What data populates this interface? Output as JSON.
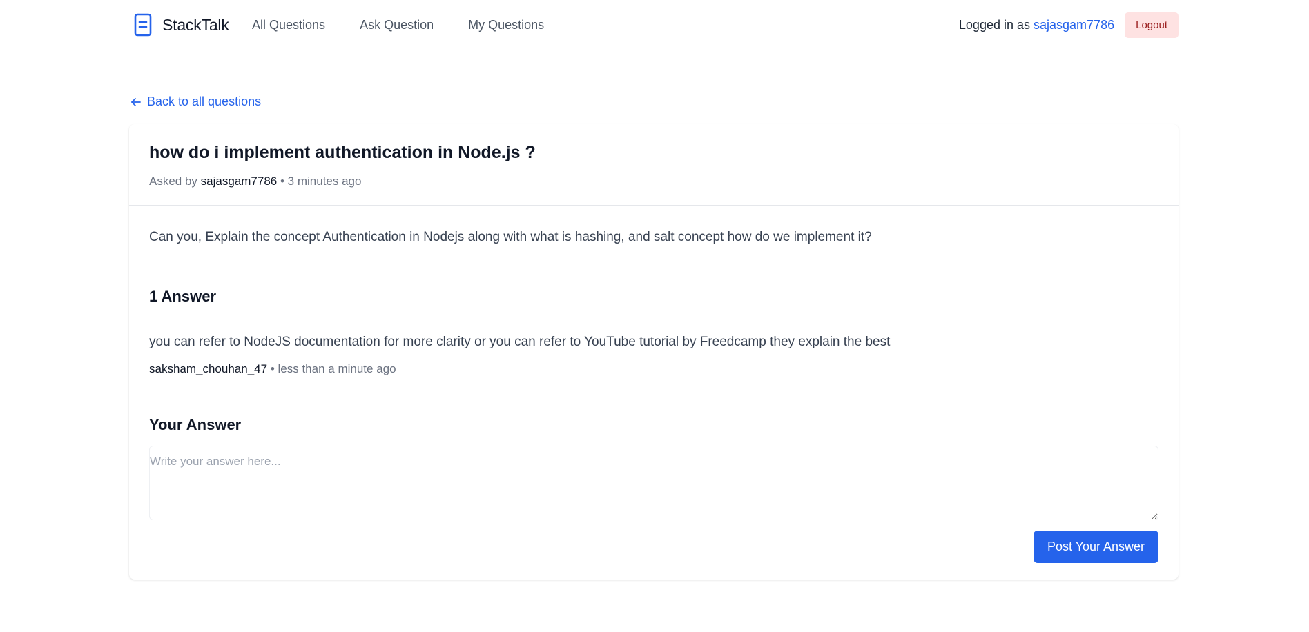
{
  "app": {
    "brand_name": "StackTalk",
    "brand_icon": "document-icon",
    "accent_color": "#2563eb"
  },
  "nav": {
    "links": [
      {
        "label": "All Questions"
      },
      {
        "label": "Ask Question"
      },
      {
        "label": "My Questions"
      }
    ],
    "logged_in_prefix": "Logged in as",
    "username": "sajasgam7786",
    "logout_label": "Logout"
  },
  "back_link": {
    "label": "Back to all questions",
    "icon": "arrow-left-icon"
  },
  "question": {
    "title": "how do i implement authentication in Node.js ?",
    "asked_by_prefix": "Asked by",
    "author": "sajasgam7786",
    "separator": "•",
    "time": "3 minutes ago",
    "body": "Can you, Explain the concept Authentication in Nodejs along with what is hashing, and salt concept how do we implement it?"
  },
  "answers": {
    "count_label": "1 Answer",
    "items": [
      {
        "body": "you can refer to NodeJS documentation for more clarity or you can refer to YouTube tutorial by Freedcamp they explain the best",
        "author": "saksham_chouhan_47",
        "separator": "•",
        "time": "less than a minute ago"
      }
    ]
  },
  "your_answer": {
    "title": "Your Answer",
    "placeholder": "Write your answer here...",
    "value": "",
    "submit_label": "Post Your Answer"
  }
}
